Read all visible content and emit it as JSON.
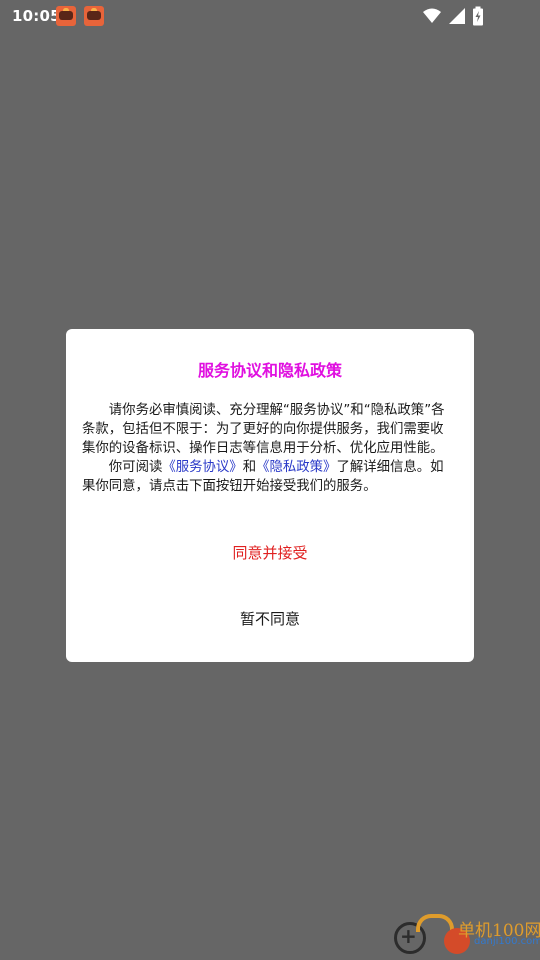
{
  "status_bar": {
    "time": "10:05",
    "notification_icons": [
      "app-notification-icon",
      "app-notification-icon"
    ],
    "system_icons": [
      "wifi-icon",
      "signal-icon",
      "battery-icon"
    ]
  },
  "dialog": {
    "title": "服务协议和隐私政策",
    "paragraph1": "请你务必审慎阅读、充分理解“服务协议”和“隐私政策”各条款，包括但不限于：为了更好的向你提供服务，我们需要收集你的设备标识、操作日志等信息用于分析、优化应用性能。",
    "paragraph2_prefix": "你可阅读",
    "service_agreement_link": "《服务协议》",
    "and_text": "和",
    "privacy_policy_link": "《隐私政策》",
    "paragraph2_suffix": "了解详细信息。如果你同意，请点击下面按钮开始接受我们的服务。",
    "accept_label": "同意并接受",
    "decline_label": "暂不同意"
  },
  "watermark": {
    "text": "单机100网",
    "subtext": "danji100.com"
  },
  "colors": {
    "overlay": "#666666",
    "title": "#e010e0",
    "link": "#2a39c8",
    "accept": "#e02020"
  }
}
